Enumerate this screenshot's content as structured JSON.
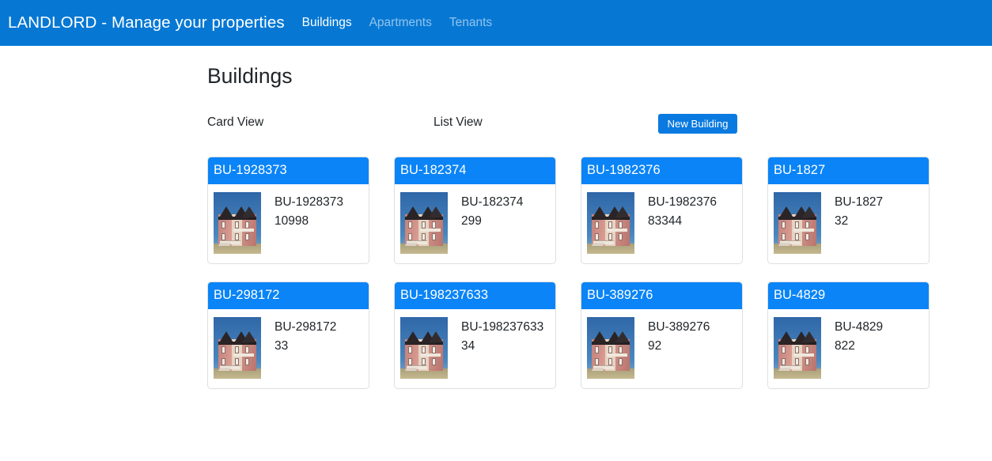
{
  "navbar": {
    "brand": "LANDLORD - Manage your properties",
    "accent_color": "#0678d4",
    "links": [
      {
        "label": "Buildings",
        "active": true
      },
      {
        "label": "Apartments",
        "active": false
      },
      {
        "label": "Tenants",
        "active": false
      }
    ]
  },
  "main": {
    "page_title": "Buildings",
    "toolbar": {
      "card_view_label": "Card View",
      "list_view_label": "List View",
      "new_building_label": "New Building",
      "button_color": "#0a7ae0"
    },
    "card_header_color": "#0a84f7",
    "cards": [
      {
        "header": "BU-1928373",
        "name": "BU-1928373",
        "value": "10998",
        "image": "building-photo"
      },
      {
        "header": "BU-182374",
        "name": "BU-182374",
        "value": "299",
        "image": "building-photo"
      },
      {
        "header": "BU-1982376",
        "name": "BU-1982376",
        "value": "83344",
        "image": "building-photo"
      },
      {
        "header": "BU-1827",
        "name": "BU-1827",
        "value": "32",
        "image": "building-photo"
      },
      {
        "header": "BU-298172",
        "name": "BU-298172",
        "value": "33",
        "image": "building-photo"
      },
      {
        "header": "BU-198237633",
        "name": "BU-198237633",
        "value": "34",
        "image": "building-photo"
      },
      {
        "header": "BU-389276",
        "name": "BU-389276",
        "value": "92",
        "image": "building-photo"
      },
      {
        "header": "BU-4829",
        "name": "BU-4829",
        "value": "822",
        "image": "building-photo"
      }
    ]
  }
}
